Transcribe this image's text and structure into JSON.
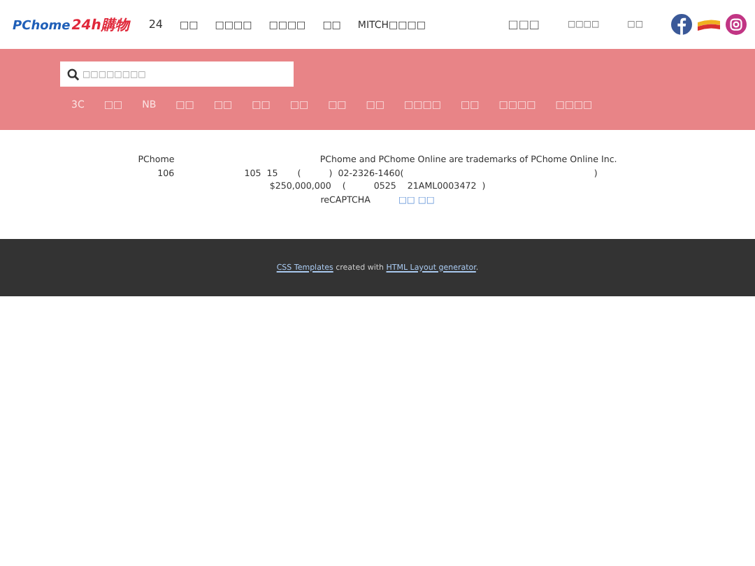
{
  "header": {
    "logo": {
      "brand": "PChome",
      "suffix": "24h購物"
    },
    "nav": [
      "24",
      "□□",
      "□□□□",
      "□□□□",
      "□□",
      "MITCH□□□□"
    ],
    "right_links": [
      "□□□",
      "□□□□",
      "□□"
    ]
  },
  "search": {
    "placeholder": "□□□□□□□□"
  },
  "categories": [
    "3C",
    "□□",
    "NB",
    "□□",
    "□□",
    "□□",
    "□□",
    "□□",
    "□□",
    "□□□□",
    "□□",
    "□□□□",
    "□□□□"
  ],
  "info": {
    "lines": [
      {
        "parts": [
          {
            "text": "PChome                                                    PChome and PChome Online are trademarks of PChome Online Inc.",
            "link": false
          }
        ]
      },
      {
        "parts": [
          {
            "text": "106                         105  15       (          )  02-2326-1460(                                                                    )",
            "link": false
          }
        ]
      },
      {
        "parts": [
          {
            "text": "$250,000,000    (          0525    21AML0003472  )",
            "link": false
          }
        ]
      },
      {
        "parts": [
          {
            "text": "reCAPTCHA          ",
            "link": false
          },
          {
            "text": "□□ □□",
            "link": true
          }
        ]
      }
    ]
  },
  "footer": {
    "parts": [
      {
        "text": "CSS Templates",
        "link": true
      },
      {
        "text": " created with ",
        "link": false
      },
      {
        "text": "HTML Layout generator",
        "link": true
      },
      {
        "text": ".",
        "link": false
      }
    ]
  }
}
